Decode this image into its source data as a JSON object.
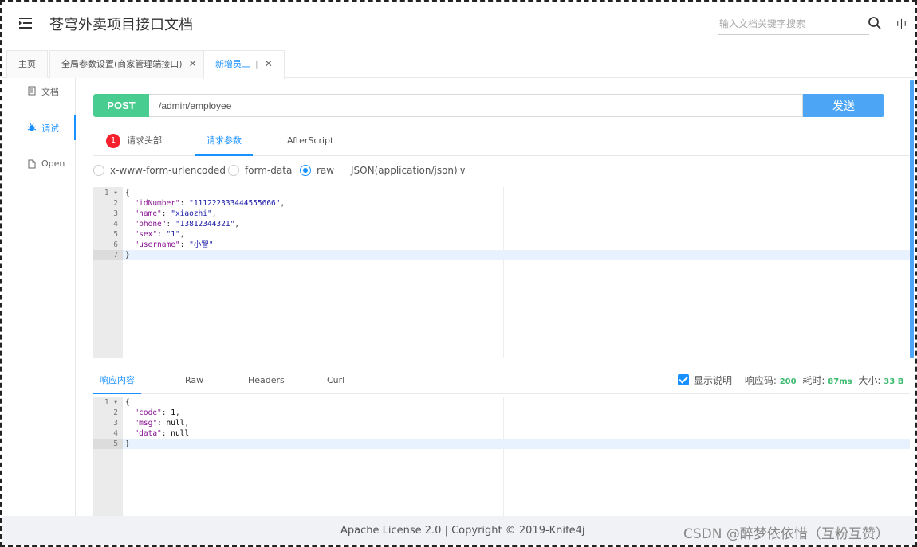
{
  "header": {
    "title": "苍穹外卖项目接口文档",
    "search_placeholder": "输入文档关键字搜索",
    "lang": "中"
  },
  "tabs": [
    {
      "label": "主页"
    },
    {
      "label": "全局参数设置(商家管理端接口)"
    },
    {
      "label": "新增员工"
    }
  ],
  "sidebar": {
    "items": [
      {
        "label": "文档",
        "icon": "document-icon"
      },
      {
        "label": "调试",
        "icon": "bug-icon"
      },
      {
        "label": "Open",
        "icon": "file-icon"
      }
    ]
  },
  "request": {
    "method": "POST",
    "url": "/admin/employee",
    "send_label": "发送",
    "tabs": {
      "headers": "请求头部",
      "headers_badge": "1",
      "params": "请求参数",
      "afterscript": "AfterScript"
    },
    "body_types": {
      "urlencoded": "x-www-form-urlencoded",
      "formdata": "form-data",
      "raw": "raw",
      "content_type": "JSON(application/json)"
    },
    "body_lines": [
      {
        "n": "1",
        "text": "{"
      },
      {
        "n": "2",
        "key": "\"idNumber\"",
        "val": "\"111222333444555666\"",
        "end": ","
      },
      {
        "n": "3",
        "key": "\"name\"",
        "val": "\"xiaozhi\"",
        "end": ","
      },
      {
        "n": "4",
        "key": "\"phone\"",
        "val": "\"13812344321\"",
        "end": ","
      },
      {
        "n": "5",
        "key": "\"sex\"",
        "val": "\"1\"",
        "end": ","
      },
      {
        "n": "6",
        "key": "\"username\"",
        "val": "\"小智\"",
        "end": ""
      },
      {
        "n": "7",
        "text": "}"
      }
    ]
  },
  "response": {
    "tabs": {
      "content": "响应内容",
      "raw": "Raw",
      "headers": "Headers",
      "curl": "Curl"
    },
    "show_desc": "显示说明",
    "code_label": "响应码:",
    "code": "200",
    "time_label": "耗时:",
    "time": "87ms",
    "size_label": "大小:",
    "size": "33 B",
    "body_lines": [
      {
        "n": "1",
        "text": "{"
      },
      {
        "n": "2",
        "key": "\"code\"",
        "val": "1",
        "end": ","
      },
      {
        "n": "3",
        "key": "\"msg\"",
        "val": "null",
        "end": ","
      },
      {
        "n": "4",
        "key": "\"data\"",
        "val": "null",
        "end": ""
      },
      {
        "n": "5",
        "text": "}"
      }
    ]
  },
  "footer": {
    "license": "Apache License 2.0 | Copyright © 2019-Knife4j",
    "watermark": "CSDN @醉梦依依惜（互粉互赞）"
  },
  "colors": {
    "post": "#49cc90",
    "accent": "#1890ff",
    "send": "#4ca5f5"
  }
}
